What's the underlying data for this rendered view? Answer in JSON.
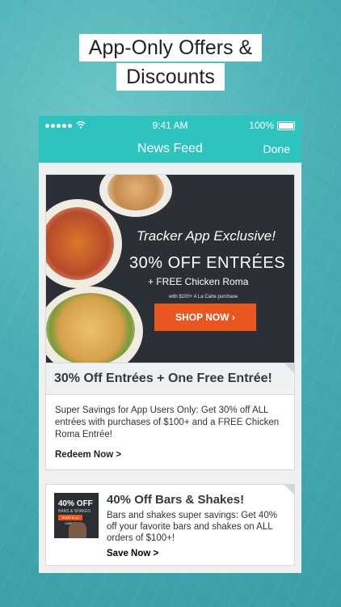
{
  "headline": {
    "line1": "App-Only Offers &",
    "line2": "Discounts"
  },
  "status_bar": {
    "time": "9:41 AM",
    "battery": "100%"
  },
  "nav": {
    "title": "News Feed",
    "done": "Done"
  },
  "card1": {
    "banner": {
      "exclusive": "Tracker App Exclusive!",
      "offer": "30% OFF ENTRÉES",
      "free": "+ FREE Chicken Roma",
      "fineprint": "with $100+ A La Carte purchase",
      "cta": "SHOP NOW  ›"
    },
    "title": "30% Off Entrées + One Free Entrée!",
    "body": "Super Savings for App Users Only: Get 30% off ALL entrées with purchases of $100+ and a FREE Chicken Roma Entrée!",
    "link": "Redeem Now >"
  },
  "card2": {
    "thumb": {
      "offer": "40% OFF",
      "sub": "BARS & SHAKES",
      "cta": "SHOP À LA CARTE"
    },
    "title": "40% Off Bars & Shakes!",
    "body": "Bars and shakes super savings: Get 40% off your favorite bars and shakes on ALL orders of $100+!",
    "link": "Save Now  >"
  },
  "colors": {
    "accent": "#2fc3c0",
    "cta": "#e85720",
    "banner_bg": "#2b3036"
  },
  "icons": [
    "signal-dots-icon",
    "wifi-icon",
    "battery-icon",
    "chevron-right-icon"
  ]
}
